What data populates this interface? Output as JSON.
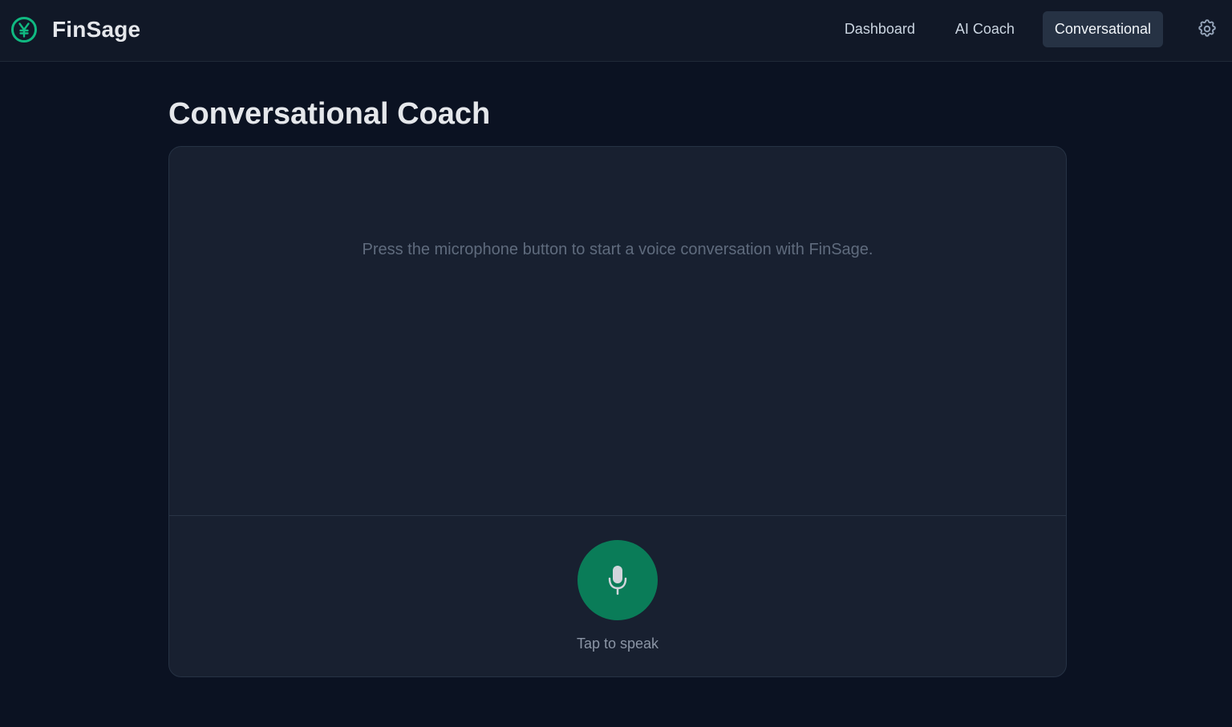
{
  "app": {
    "name": "FinSage",
    "logo_icon": "yen-circle-icon",
    "accent_color": "#10b981"
  },
  "nav": {
    "items": [
      {
        "label": "Dashboard",
        "active": false
      },
      {
        "label": "AI Coach",
        "active": false
      },
      {
        "label": "Conversational",
        "active": true
      }
    ],
    "settings_icon": "gear-icon"
  },
  "main": {
    "title": "Conversational Coach",
    "transcript": {
      "placeholder": "Press the microphone button to start a voice conversation with FinSage."
    },
    "voice": {
      "icon": "microphone-icon",
      "button_color": "#0a7c58",
      "label": "Tap to speak"
    }
  }
}
